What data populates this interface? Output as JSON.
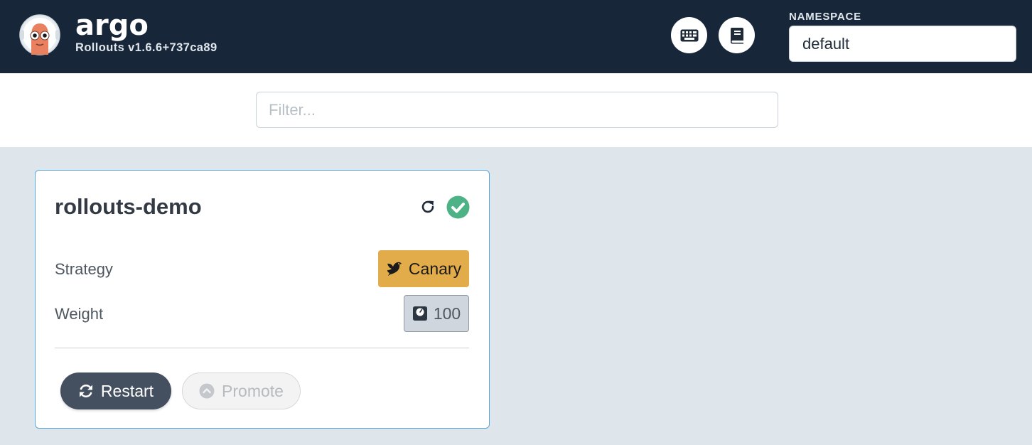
{
  "header": {
    "brand": "argo",
    "version": "Rollouts v1.6.6+737ca89",
    "icons": [
      "argo-mascot-logo",
      "keyboard-icon",
      "book-icon"
    ],
    "namespace_label": "NAMESPACE",
    "namespace_value": "default"
  },
  "filter": {
    "placeholder": "Filter..."
  },
  "rollouts": [
    {
      "name": "rollouts-demo",
      "status": "healthy",
      "strategy_label": "Strategy",
      "strategy_value": "Canary",
      "weight_label": "Weight",
      "weight_value": "100",
      "restart_label": "Restart",
      "promote_label": "Promote",
      "promote_enabled": false
    }
  ],
  "colors": {
    "header_bg": "#18263a",
    "page_bg": "#dee6eb",
    "card_border": "#5aa8db",
    "canary": "#e2ac4a",
    "healthy": "#4db386",
    "restart_bg": "#444f5f"
  }
}
